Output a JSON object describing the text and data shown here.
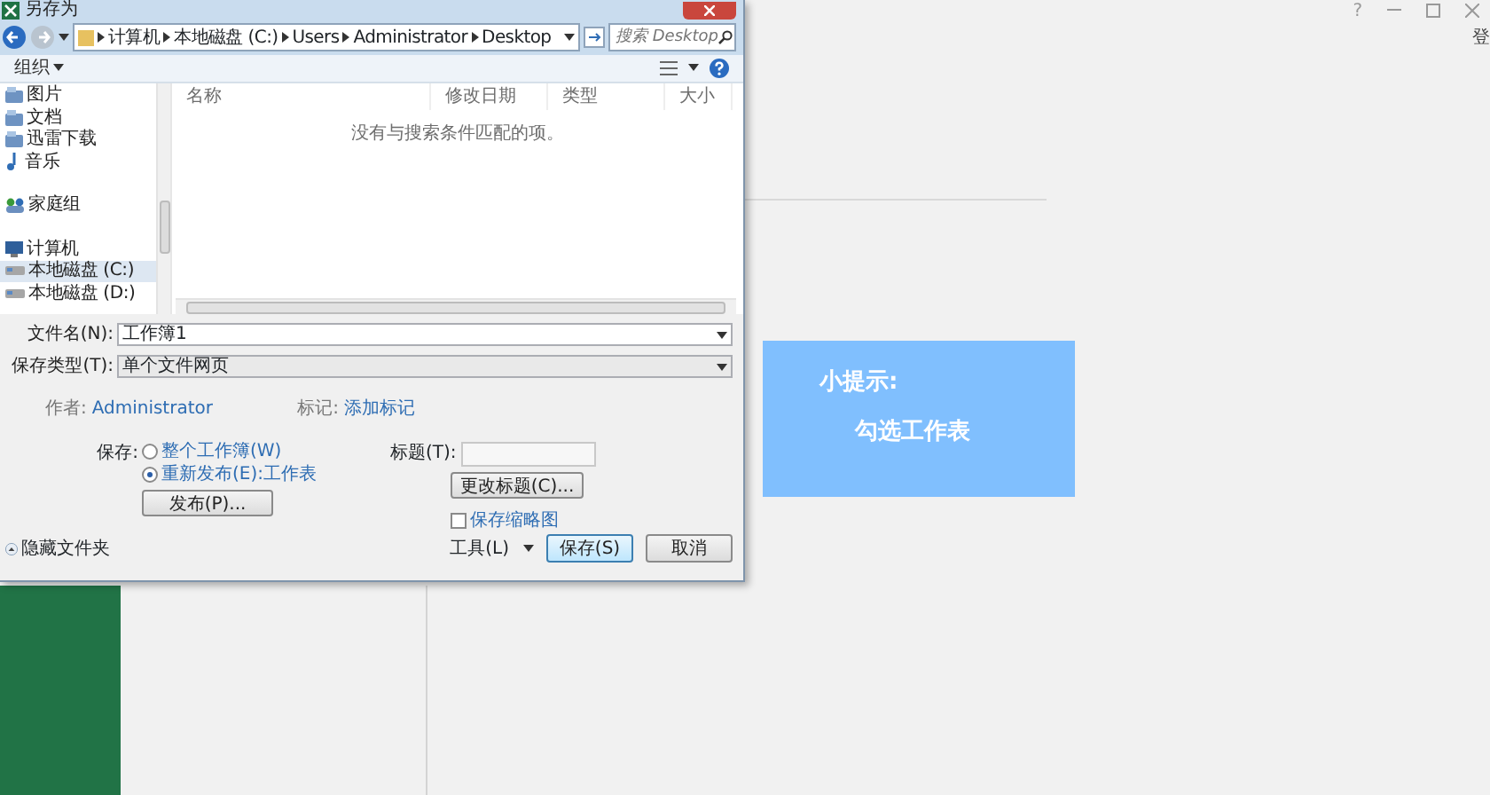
{
  "window_title": "另存为",
  "app_controls": {
    "help": "?",
    "login": "登"
  },
  "breadcrumb": [
    "计算机",
    "本地磁盘 (C:)",
    "Users",
    "Administrator",
    "Desktop"
  ],
  "search": {
    "placeholder": "搜索 Desktop"
  },
  "toolbar": {
    "organize": "组织"
  },
  "nav_items": [
    {
      "label": "图片",
      "kind": "library",
      "selected": false
    },
    {
      "label": "文档",
      "kind": "library",
      "selected": false
    },
    {
      "label": "迅雷下载",
      "kind": "library",
      "selected": false
    },
    {
      "label": "音乐",
      "kind": "music",
      "selected": false
    },
    {
      "label": "家庭组",
      "kind": "homegroup",
      "selected": false
    },
    {
      "label": "计算机",
      "kind": "computer",
      "selected": false
    },
    {
      "label": "本地磁盘 (C:)",
      "kind": "drive",
      "selected": true
    },
    {
      "label": "本地磁盘 (D:)",
      "kind": "drive",
      "selected": false
    }
  ],
  "columns": [
    "名称",
    "修改日期",
    "类型",
    "大小"
  ],
  "empty_message": "没有与搜索条件匹配的项。",
  "file_name": {
    "label": "文件名(N):",
    "value": "工作簿1"
  },
  "save_type": {
    "label": "保存类型(T):",
    "value": "单个文件网页"
  },
  "author": {
    "label": "作者:",
    "value": "Administrator"
  },
  "tags": {
    "label": "标记:",
    "value": "添加标记"
  },
  "save_label": "保存:",
  "save_options": [
    {
      "label": "整个工作簿(W)",
      "selected": false
    },
    {
      "label": "重新发布(E):工作表",
      "selected": true
    }
  ],
  "publish_button": "发布(P)...",
  "title_field": {
    "label": "标题(T):"
  },
  "change_title_button": "更改标题(C)...",
  "thumbnail": {
    "label": "保存缩略图",
    "checked": false
  },
  "hide_folders": "隐藏文件夹",
  "tools": "工具(L)",
  "buttons": [
    "保存(S)",
    "取消"
  ],
  "tip": {
    "title": "小提示:",
    "text": "勾选工作表"
  }
}
